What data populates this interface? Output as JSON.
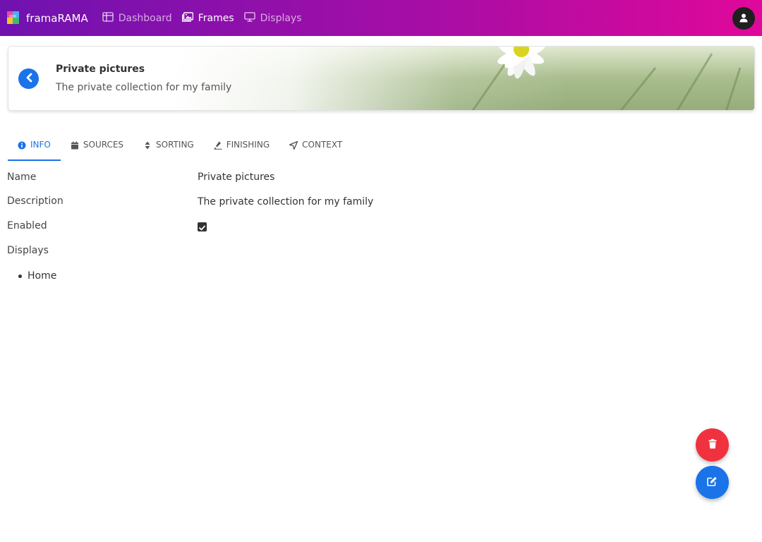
{
  "app": {
    "brand": "framaRAMA"
  },
  "nav": [
    {
      "label": "Dashboard",
      "icon": "dashboard-icon",
      "active": false
    },
    {
      "label": "Frames",
      "icon": "images-icon",
      "active": true
    },
    {
      "label": "Displays",
      "icon": "monitor-icon",
      "active": false
    }
  ],
  "header": {
    "title": "Private pictures",
    "subtitle": "The private collection for my family"
  },
  "tabs": [
    {
      "label": "INFO",
      "icon": "info-icon",
      "active": true
    },
    {
      "label": "SOURCES",
      "icon": "calendar-icon",
      "active": false
    },
    {
      "label": "SORTING",
      "icon": "sort-icon",
      "active": false
    },
    {
      "label": "FINISHING",
      "icon": "brush-icon",
      "active": false
    },
    {
      "label": "CONTEXT",
      "icon": "location-arrow-icon",
      "active": false
    }
  ],
  "info": {
    "name_label": "Name",
    "name_value": "Private pictures",
    "description_label": "Description",
    "description_value": "The private collection for my family",
    "enabled_label": "Enabled",
    "enabled_value": true,
    "displays_label": "Displays",
    "displays": [
      "Home"
    ]
  },
  "colors": {
    "primary": "#1a73e8",
    "danger": "#f0323f",
    "navbar_start": "#6f12b0",
    "navbar_end": "#e0089a"
  }
}
